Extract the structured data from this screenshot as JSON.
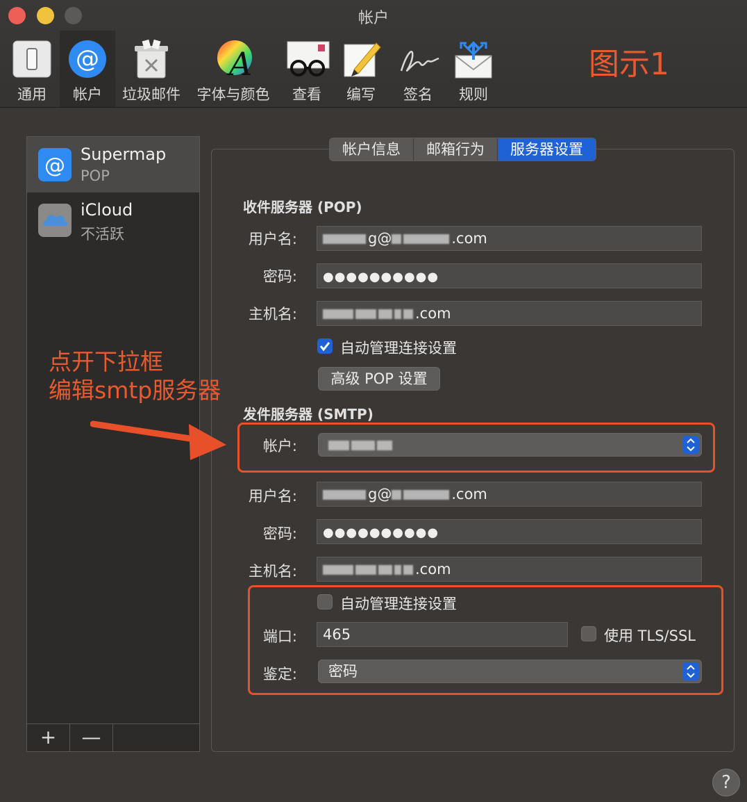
{
  "window": {
    "title": "帐户"
  },
  "toolbar": {
    "items": [
      {
        "label": "通用"
      },
      {
        "label": "帐户"
      },
      {
        "label": "垃圾邮件"
      },
      {
        "label": "字体与颜色"
      },
      {
        "label": "查看"
      },
      {
        "label": "编写"
      },
      {
        "label": "签名"
      },
      {
        "label": "规则"
      }
    ]
  },
  "figure_label": "图示1",
  "annotation": {
    "line1": "点开下拉框",
    "line2": "编辑smtp服务器"
  },
  "sidebar": {
    "accounts": [
      {
        "name": "Supermap",
        "type": "POP",
        "icon": "at-icon"
      },
      {
        "name": "iCloud",
        "type": "不活跃",
        "icon": "cloud-icon"
      }
    ],
    "add": "+",
    "remove": "—"
  },
  "tabs": [
    {
      "label": "帐户信息"
    },
    {
      "label": "邮箱行为"
    },
    {
      "label": "服务器设置"
    }
  ],
  "incoming": {
    "title": "收件服务器 (POP)",
    "username_label": "用户名:",
    "username_value": "g@",
    "username_suffix": ".com",
    "password_label": "密码:",
    "password_value": "●●●●●●●●●●",
    "host_label": "主机名:",
    "host_suffix": ".com",
    "auto_manage_label": "自动管理连接设置",
    "auto_manage_checked": true,
    "advanced_button": "高级 POP 设置"
  },
  "outgoing": {
    "title": "发件服务器 (SMTP)",
    "account_label": "帐户:",
    "username_label": "用户名:",
    "username_value": "g@",
    "username_suffix": ".com",
    "password_label": "密码:",
    "password_value": "●●●●●●●●●●",
    "host_label": "主机名:",
    "host_suffix": ".com",
    "auto_manage_label": "自动管理连接设置",
    "auto_manage_checked": false,
    "port_label": "端口:",
    "port_value": "465",
    "tls_label": "使用 TLS/SSL",
    "tls_checked": false,
    "auth_label": "鉴定:",
    "auth_value": "密码"
  },
  "help": "?",
  "colors": {
    "accent": "#1f62d6",
    "annotation": "#e85a30",
    "highlight_box": "#e8502a"
  }
}
